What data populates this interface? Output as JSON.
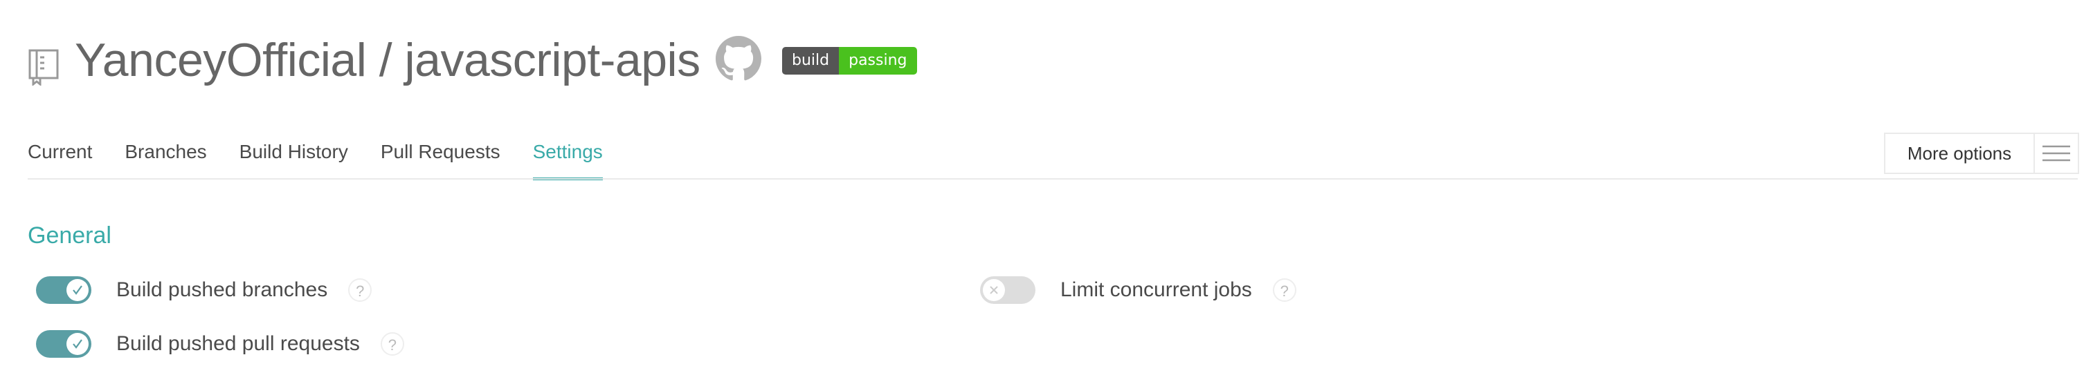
{
  "header": {
    "repo_title": "YanceyOfficial / javascript-apis",
    "badge": {
      "left": "build",
      "right": "passing"
    }
  },
  "tabs": [
    {
      "label": "Current"
    },
    {
      "label": "Branches"
    },
    {
      "label": "Build History"
    },
    {
      "label": "Pull Requests"
    },
    {
      "label": "Settings",
      "active": true
    }
  ],
  "more_options": {
    "label": "More options"
  },
  "general": {
    "title": "General",
    "settings": [
      {
        "label": "Build pushed branches",
        "enabled": true
      },
      {
        "label": "Build pushed pull requests",
        "enabled": true
      },
      {
        "label": "Limit concurrent jobs",
        "enabled": false
      }
    ],
    "help_glyph": "?"
  },
  "colors": {
    "accent": "#39aaa8",
    "toggle_on": "#5a9ea4",
    "toggle_off": "#dddddd",
    "badge_dark": "#555555",
    "badge_green": "#4ac11e"
  },
  "icons": [
    "repo-icon",
    "github-icon",
    "hamburger-menu-icon",
    "check-icon",
    "x-icon",
    "help-icon"
  ]
}
